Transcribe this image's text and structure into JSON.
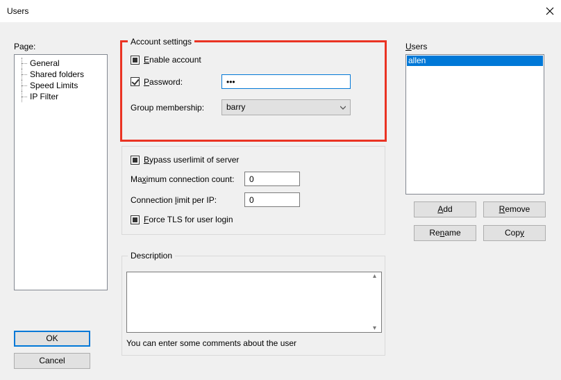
{
  "window": {
    "title": "Users"
  },
  "page": {
    "label": "Page:",
    "items": [
      "General",
      "Shared folders",
      "Speed Limits",
      "IP Filter"
    ]
  },
  "buttons": {
    "ok": "OK",
    "cancel": "Cancel"
  },
  "account": {
    "legend": "Account settings",
    "enable": {
      "label_pre": "",
      "label_u": "E",
      "label_post": "nable account",
      "state": "square"
    },
    "password": {
      "label_u": "P",
      "label_post": "assword:",
      "value": "•••",
      "state": "check"
    },
    "group": {
      "label": "Group membership:",
      "value": "barry"
    }
  },
  "limits": {
    "bypass": {
      "label_u": "B",
      "label_post": "ypass userlimit of server",
      "state": "square"
    },
    "maxconn": {
      "label_pre": "Ma",
      "label_u": "x",
      "label_post": "imum connection count:",
      "value": "0"
    },
    "perip": {
      "label_pre": "Connection ",
      "label_u": "l",
      "label_post": "imit per IP:",
      "value": "0"
    },
    "forcetls": {
      "label_u": "F",
      "label_post": "orce TLS for user login",
      "state": "square"
    }
  },
  "description": {
    "legend": "Description",
    "hint": "You can enter some comments about the user",
    "value": ""
  },
  "users": {
    "label_u": "U",
    "label_post": "sers",
    "items": [
      "allen"
    ],
    "selected": 0,
    "buttons": {
      "add": {
        "u": "A",
        "post": "dd"
      },
      "remove": {
        "u": "R",
        "post": "emove"
      },
      "rename": {
        "pre": "Re",
        "u": "n",
        "post": "ame"
      },
      "copy": {
        "pre": "Cop",
        "u": "y",
        "post": ""
      }
    }
  }
}
